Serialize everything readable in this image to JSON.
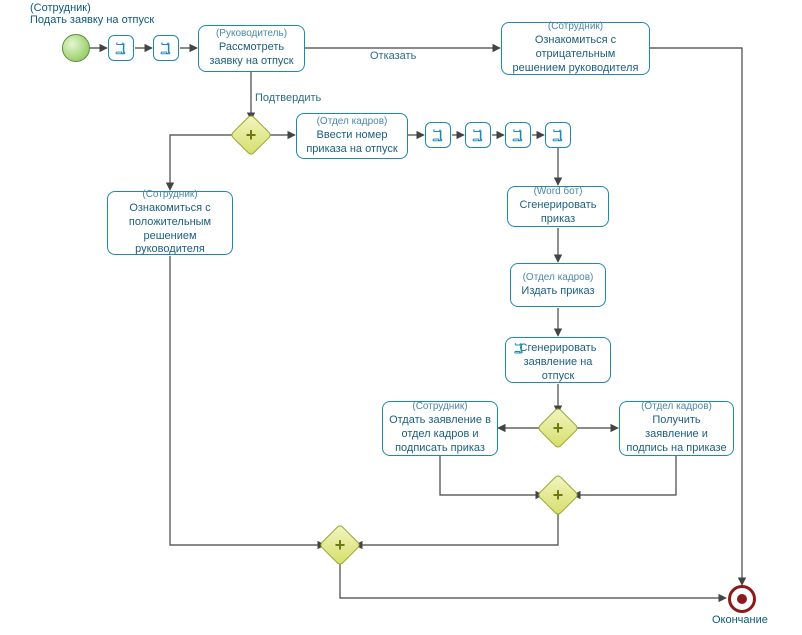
{
  "diagram": {
    "title_role": "(Сотрудник)",
    "title_name": "Подать заявку на отпуск",
    "end_label": "Окончание",
    "edge_labels": {
      "reject": "Отказать",
      "approve": "Подтвердить"
    },
    "tasks": {
      "review": {
        "role": "(Руководитель)",
        "name": "Рассмотреть заявку на отпуск"
      },
      "neg": {
        "role": "(Сотрудник)",
        "name": "Ознакомиться с отрицательным решением руководителя"
      },
      "pos": {
        "role": "(Сотрудник)",
        "name": "Ознакомиться с положительным решением руководителя"
      },
      "ordernum": {
        "role": "(Отдел кадров)",
        "name": "Ввести номер приказа на отпуск"
      },
      "gen_order": {
        "role": "(Word бот)",
        "name": "Сгенерировать приказ"
      },
      "issue": {
        "role": "(Отдел кадров)",
        "name": "Издать приказ"
      },
      "gen_app": {
        "role": "",
        "name": "Сгенерировать заявление на отпуск"
      },
      "sign": {
        "role": "(Сотрудник)",
        "name": "Отдать заявление в отдел кадров и подписать приказ"
      },
      "receive": {
        "role": "(Отдел кадров)",
        "name": "Получить заявление и подпись на приказе"
      }
    }
  }
}
